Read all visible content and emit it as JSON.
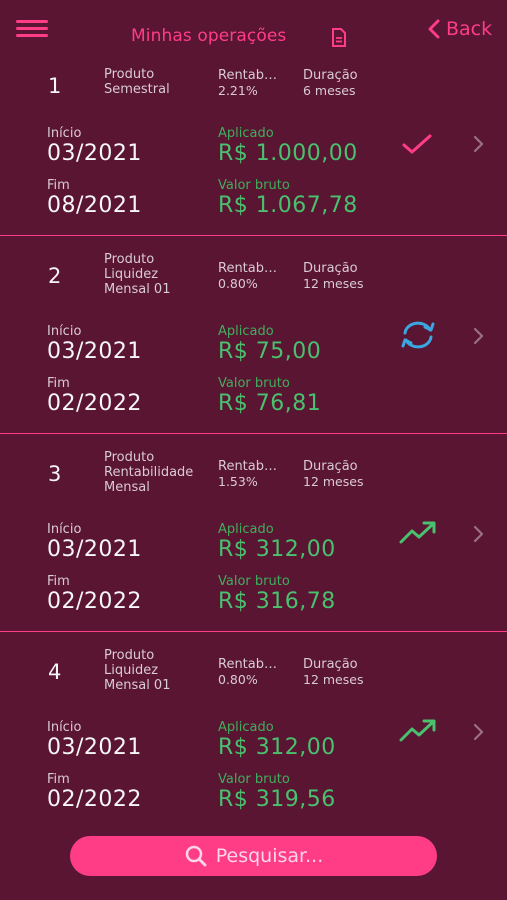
{
  "header": {
    "title": "Minhas operações",
    "back_label": "Back"
  },
  "labels": {
    "produto": "Produto",
    "rentab": "Rentab…",
    "duracao": "Duração",
    "inicio": "Início",
    "fim": "Fim",
    "aplicado": "Aplicado",
    "valor_bruto": "Valor bruto"
  },
  "operations": [
    {
      "index": "1",
      "produto": "Semestral",
      "rentab": "2.21%",
      "duracao": "6 meses",
      "inicio": "03/2021",
      "fim": "08/2021",
      "aplicado": "R$ 1.000,00",
      "valor_bruto": "R$ 1.067,78",
      "status_icon": "check-icon"
    },
    {
      "index": "2",
      "produto": "Liquidez\nMensal 01",
      "rentab": "0.80%",
      "duracao": "12 meses",
      "inicio": "03/2021",
      "fim": "02/2022",
      "aplicado": "R$ 75,00",
      "valor_bruto": "R$ 76,81",
      "status_icon": "sync-icon"
    },
    {
      "index": "3",
      "produto": "Rentabilidade\nMensal",
      "rentab": "1.53%",
      "duracao": "12 meses",
      "inicio": "03/2021",
      "fim": "02/2022",
      "aplicado": "R$ 312,00",
      "valor_bruto": "R$ 316,78",
      "status_icon": "trending-up-icon"
    },
    {
      "index": "4",
      "produto": "Liquidez\nMensal 01",
      "rentab": "0.80%",
      "duracao": "12 meses",
      "inicio": "03/2021",
      "fim": "02/2022",
      "aplicado": "R$ 312,00",
      "valor_bruto": "R$ 319,56",
      "status_icon": "trending-up-icon"
    }
  ],
  "search": {
    "placeholder": "Pesquisar..."
  },
  "colors": {
    "background": "#5a1533",
    "accent": "#ff3d86",
    "money": "#49c16e",
    "sync": "#3aa7e0"
  }
}
